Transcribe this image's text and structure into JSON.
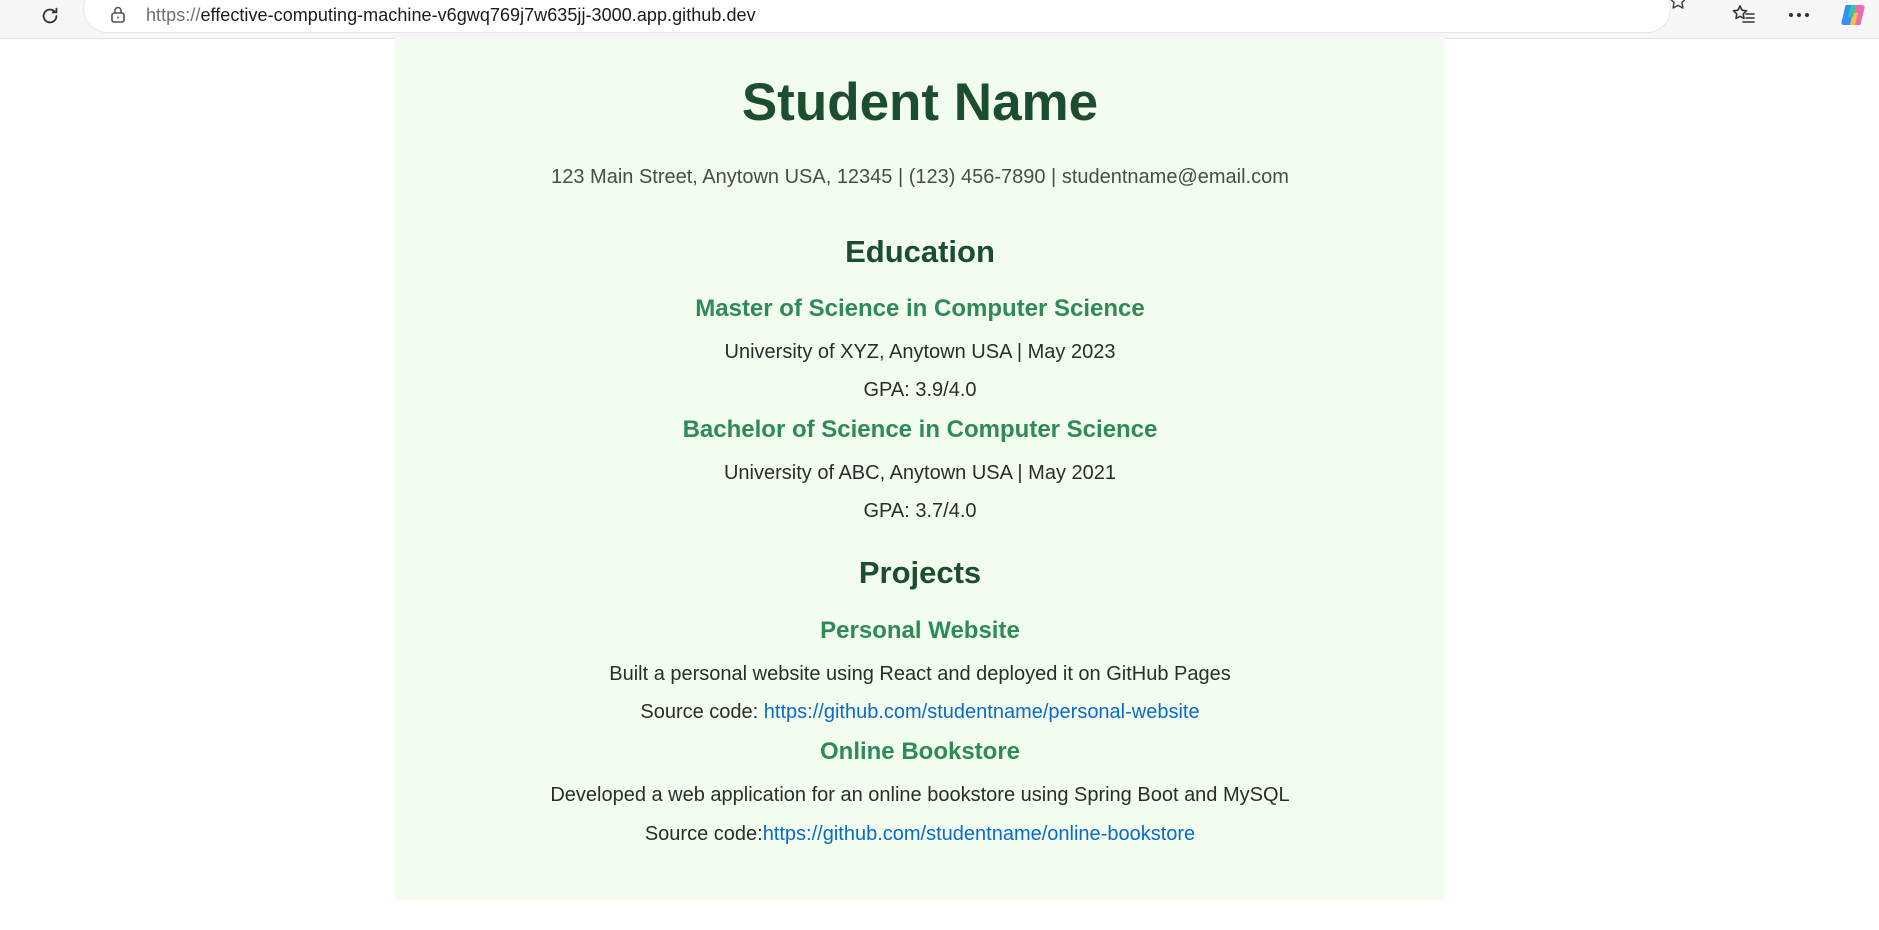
{
  "browser": {
    "url_protocol": "https://",
    "url_host": "effective-computing-machine-v6gwq769j7w635jj-3000.app.github.dev",
    "icons": [
      "reload-icon",
      "lock-icon",
      "star-icon",
      "favorites-icon",
      "more-icon",
      "copilot-icon"
    ]
  },
  "header": {
    "name": "Student Name",
    "contact": "123 Main Street, Anytown USA, 12345 | (123) 456-7890 | studentname@email.com"
  },
  "education": {
    "title": "Education",
    "items": [
      {
        "degree": "Master of Science in Computer Science",
        "school": "University of XYZ, Anytown USA | May 2023",
        "gpa": "GPA: 3.9/4.0"
      },
      {
        "degree": "Bachelor of Science in Computer Science",
        "school": "University of ABC, Anytown USA | May 2021",
        "gpa": "GPA: 3.7/4.0"
      }
    ]
  },
  "projects": {
    "title": "Projects",
    "items": [
      {
        "name": "Personal Website",
        "description": "Built a personal website using React and deployed it on GitHub Pages",
        "source_label": "Source code: ",
        "source_link": "https://github.com/studentname/personal-website"
      },
      {
        "name": "Online Bookstore",
        "description": "Developed a web application for an online bookstore using Spring Boot and MySQL",
        "source_label": "Source code:",
        "source_link": "https://github.com/studentname/online-bookstore"
      }
    ]
  },
  "colors": {
    "page_background": "#f2fdef",
    "heading": "#1b4d2e",
    "subheading": "#2e8b57",
    "link": "#0a6ac7"
  }
}
